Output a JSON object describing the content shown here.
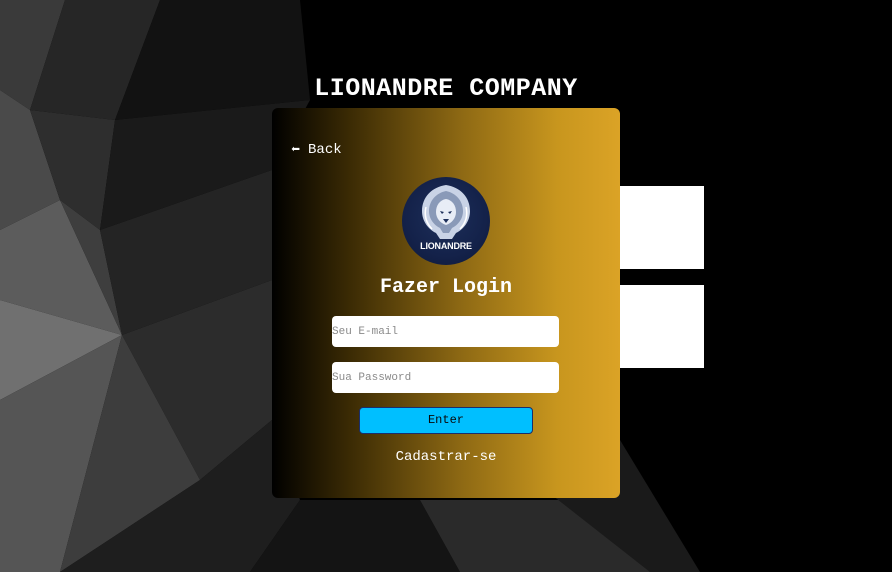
{
  "header": {
    "company_title": "LIONANDRE COMPANY"
  },
  "login_card": {
    "back_label": "Back",
    "back_icon": "arrow-left-icon",
    "logo_text": "LIONANDRE",
    "heading": "Fazer Login",
    "email": {
      "value": "",
      "placeholder": "Seu E-mail"
    },
    "password": {
      "value": "",
      "placeholder": "Sua Password"
    },
    "enter_label": "Enter",
    "register_label": "Cadastrar-se"
  },
  "colors": {
    "background": "#000000",
    "card_gradient_start": "#000000",
    "card_gradient_end": "#dba326",
    "enter_button": "#00bfff",
    "text": "#ffffff"
  }
}
